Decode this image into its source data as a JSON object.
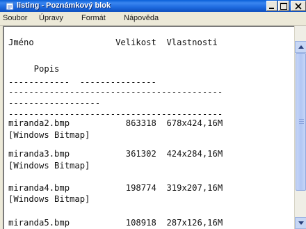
{
  "window": {
    "title": "listing - Poznámkový blok",
    "icon": "notepad-icon"
  },
  "menu": [
    "Soubor",
    "Úpravy",
    "Formát",
    "Nápověda"
  ],
  "editor": {
    "lines": [
      "Jméno                Velikost  Vlastnosti",
      "",
      "     Popis",
      "------------  ---------------",
      "------------------------------------------",
      "------------------",
      "------------------------------------------",
      "miranda2.bmp           863318  678x424,16M",
      "[Windows Bitmap]",
      "miranda3.bmp           361302  424x284,16M",
      "[Windows Bitmap]",
      "miranda4.bmp           198774  319x207,16M",
      "[Windows Bitmap]",
      "miranda5.bmp           108918  287x126,16M"
    ]
  },
  "colors": {
    "titlebar": "#0c5fd8",
    "background": "#5fae3c"
  }
}
